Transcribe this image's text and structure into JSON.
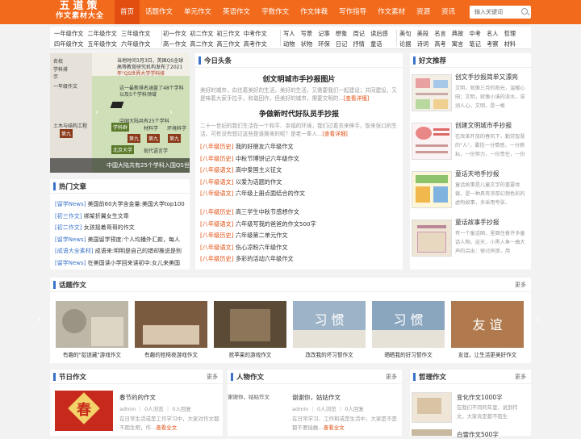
{
  "logo": {
    "line1": "五道策",
    "line2": "作文素材大全"
  },
  "nav": [
    "首页",
    "话题作文",
    "单元作文",
    "英语作文",
    "字数作文",
    "作文体裁",
    "写作指导",
    "作文素材",
    "资源",
    "资讯"
  ],
  "search": {
    "placeholder": "输入关键词"
  },
  "categories": {
    "g1": [
      "一年级作文",
      "二年级作文",
      "三年级作文",
      "四年级作文",
      "五年级作文",
      "六年级作文"
    ],
    "g2": [
      "初一作文",
      "初二作文",
      "初三作文",
      "中考作文",
      "高一作文",
      "高二作文",
      "高三作文",
      "高考作文"
    ],
    "g3": [
      "写人",
      "写景",
      "记事",
      "想象",
      "周记",
      "读后感",
      "动物",
      "状物",
      "环保",
      "日记",
      "抒情",
      "童话"
    ],
    "g4": [
      "美句",
      "美段",
      "名言",
      "典故",
      "中考",
      "名人",
      "哲理",
      "论据",
      "诗词",
      "高考",
      "寓言",
      "笔记",
      "考察",
      "材料"
    ]
  },
  "slider": {
    "caption": "中国大陆共有25个学科入围QS世",
    "texts": [
      "当地时间3月3日，英国QS全球",
      "高等教育研究机构发布了2021",
      "年\"QS世界大学学科排",
      "一年级作文",
      "名校",
      "学科排",
      "示",
      "土木与结构工程",
      "这一最新排名涵盖了48个学科",
      "以及5个学科领域",
      "中国大陆共有25个学科",
      "第九",
      "学科群",
      "材料学",
      "环境科学",
      "北京大学",
      "现代语言学",
      "第九",
      "第九",
      "第九"
    ]
  },
  "hot": {
    "title": "热门文章",
    "items": [
      {
        "tag": "[留学News]",
        "text": "美国前60大学含金量:美国大学top100"
      },
      {
        "tag": "[初三作文]",
        "text": "绑架折翼女生文章"
      },
      {
        "tag": "[初二作文]",
        "text": "女孩摇着哥哥的作文"
      },
      {
        "tag": "[留学News]",
        "text": "美国留学预度:个人均播外汇款，每人"
      },
      {
        "tag": "[成语大全素材]",
        "text": "成语来:明明是自己的错却推说是别"
      },
      {
        "tag": "[留学News]",
        "text": "在美国读小学回来读初中:女儿来美国"
      }
    ]
  },
  "today": {
    "title": "今日头条",
    "h1": "创文明城市手抄报图片",
    "p1": "美好的城市，向往着美好的生活，美好的生活，又需要我们一起建设；共同建设，又是味着大家手拉手，和谐团作，但美好的城市，需要文明的...",
    "more1": "[查看详细]",
    "h2": "争做新时代好队员手抄报",
    "p2": "二十一世纪的我们生活在一个和平、幸福的环境，我们过着衣来伸手，饭来张口的生活，可有没有想过这些是谁换来的呢？是老一辈人...",
    "more2": "[查看详细]",
    "list1": [
      {
        "tag": "[八年级历史]",
        "text": "我的好朋友六年级作文"
      },
      {
        "tag": "[八年级历史]",
        "text": "中秋节博饼记六年级作文"
      },
      {
        "tag": "[八年级语文]",
        "text": "高中爱国主义征文"
      },
      {
        "tag": "[八年级语文]",
        "text": "以爱为话题的作文"
      },
      {
        "tag": "[八年级语文]",
        "text": "六年级上册点面结合的作文"
      }
    ],
    "list2": [
      {
        "tag": "[八年级历史]",
        "text": "高三学生中秋节感想作文"
      },
      {
        "tag": "[八年级语文]",
        "text": "六年级写我的爸爸的作文500字"
      },
      {
        "tag": "[八年级历史]",
        "text": "六年级第二单元作文"
      },
      {
        "tag": "[八年级语文]",
        "text": "伤心凉粉六年级作文"
      },
      {
        "tag": "[八年级历史]",
        "text": "多彩的活动六年级作文"
      }
    ]
  },
  "friend": {
    "title": "好文推荐",
    "items": [
      {
        "title": "创文手抄报简单又漂亮",
        "desc": "文明，就像三月的阳光，温暖心田；文明，就像小溪的流水，滋润人心。文明，是一根"
      },
      {
        "title": "创建文明城市手抄报",
        "desc": "在改革开放的春风下，勤劳智慧的\"人\"，囊括一分情感，一分耕耘，一份努力，一份责任，一份正"
      },
      {
        "title": "童话天地手抄报",
        "desc": "童话故事是儿童文学的重要体裁，是一种具有浓厚幻想色彩的虚构故事，多采用夸张、"
      },
      {
        "title": "童话故事手抄报",
        "desc": "有一个童话国，里面住着许多童话人物。这天，小黑人鱼一曲大声的吕出：很讨厌那，用"
      }
    ]
  },
  "topic": {
    "title": "话题作文",
    "more": "更多",
    "items": [
      {
        "caption": "有趣的\"捉迷藏\"游戏作文"
      },
      {
        "caption": "有趣的抢椅夜游戏作文"
      },
      {
        "caption": "抢苹果的游戏作文"
      },
      {
        "caption": "改改我的坏习惯作文"
      },
      {
        "caption": "晒晒我的好习惯作文"
      },
      {
        "caption": "友谊，让生活更美好作文"
      }
    ],
    "img_words": [
      "习 惯",
      "习 惯",
      "友 谊"
    ]
  },
  "festival": {
    "title": "节日作文",
    "more": "更多",
    "post_title": "春节的的作文",
    "meta": "admin ｜ 0人浏览 ｜ 0人回复",
    "excerpt": "在日常生活或是工作学习中，大家对作文都不陌生吧，作...",
    "more_link": "查看全文",
    "badge": "春"
  },
  "people": {
    "title": "人物作文",
    "more": "更多",
    "img_alt": "谢谢你，姑姑作文",
    "post_title": "谢谢你，姑姑作文",
    "meta": "admin ｜ 0人浏览 ｜ 0人回复",
    "excerpt": "在日常学习、工作和或是生活中，大家是不是都不要接触...",
    "more_link": "查看全文"
  },
  "philo": {
    "title": "哲理作文",
    "more": "更多",
    "items": [
      {
        "title": "变化作文1000字",
        "desc": "在我们不同的年里，说到作文，大家肯定都不陌生"
      },
      {
        "title": "白雪作文500字"
      }
    ]
  },
  "colors": {
    "brand": "#f26b1d",
    "brand_dark": "#e14e10",
    "accent": "#3a73c8"
  }
}
